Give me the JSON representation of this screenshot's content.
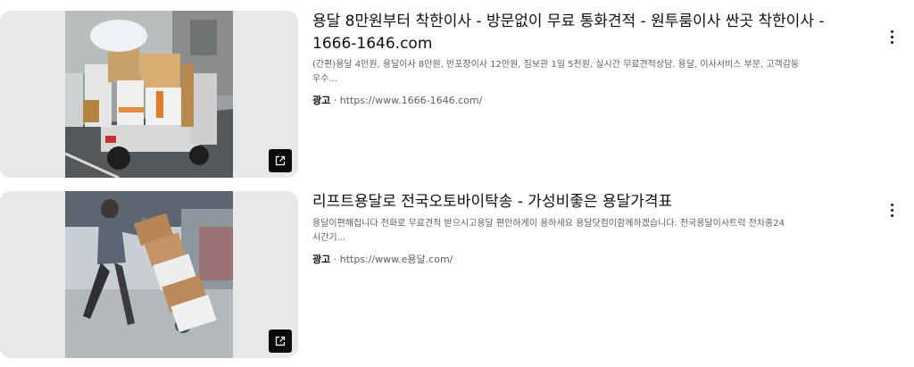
{
  "ads": [
    {
      "title_line1": "용달 8만원부터 착한이사 - 방문없이 무료 통화견적 - 원투룸이사 싼곳 착한이사 -",
      "title_line2": "1666-1646.com",
      "desc_line1": "(간편)용달 4만원, 용달이사 8만원, 반포장이사 12만원, 짐보관 1일 5천원, 실시간 무료견적상담. 용달, 이사서비스 부문, 고객감동",
      "desc_line2": "우수...",
      "ad_label": "광고",
      "separator": "·",
      "url": "https://www.1666-1646.com/",
      "image": "moving-truck-photo",
      "badge_icon": "open-external-icon",
      "menu_icon": "more-vert-icon"
    },
    {
      "title_line1": "리프트용달로 전국오토바이탁송 - 가성비좋은 용달가격표",
      "desc_line1": "용달이편해집니다 전화로 무료견적 받으시고용달 편안하게이 용하세요 용달닷컴이함께하겠습니다. 전국용달이사트럭 전차종24",
      "desc_line2": "시간기...",
      "ad_label": "광고",
      "separator": "·",
      "url": "https://www.e용달.com/",
      "image": "hand-truck-delivery-photo",
      "badge_icon": "open-external-icon",
      "menu_icon": "more-vert-icon"
    }
  ]
}
